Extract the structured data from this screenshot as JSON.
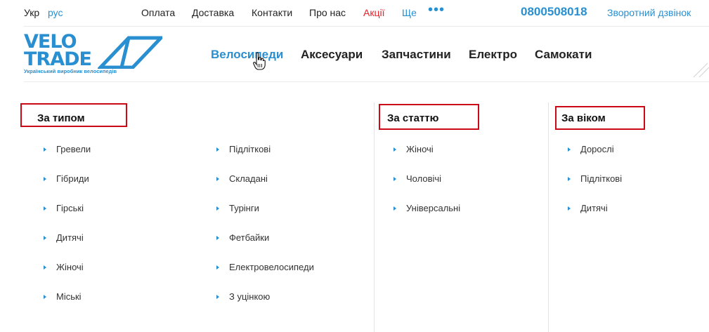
{
  "topbar": {
    "lang_ukr": "Укр",
    "lang_rus": "рус",
    "links": [
      "Оплата",
      "Доставка",
      "Контакти",
      "Про нас",
      "Акції",
      "Ще"
    ],
    "more_dots": "•••",
    "phone": "0800508018",
    "callback": "Зворотний дзвінок"
  },
  "logo": {
    "line1": "VELO",
    "line2": "TRADE",
    "tagline": "Український виробник велосипедів"
  },
  "main_nav": [
    "Велосипеди",
    "Аксесуари",
    "Запчастини",
    "Електро",
    "Самокати"
  ],
  "menu": {
    "by_type": {
      "heading": "За типом",
      "col1": [
        "Гревели",
        "Гібриди",
        "Гірські",
        "Дитячі",
        "Жіночі",
        "Міські"
      ],
      "col2": [
        "Підліткові",
        "Складані",
        "Турінги",
        "Фетбайки",
        "Електровелосипеди",
        "З уцінкою"
      ]
    },
    "by_gender": {
      "heading": "За статтю",
      "items": [
        "Жіночі",
        "Чоловічі",
        "Універсальні"
      ]
    },
    "by_age": {
      "heading": "За віком",
      "items": [
        "Дорослі",
        "Підліткові",
        "Дитячі"
      ]
    }
  },
  "colors": {
    "accent": "#2a8fd0",
    "promo": "#e5212b",
    "highlight_box": "#cc0a17"
  }
}
